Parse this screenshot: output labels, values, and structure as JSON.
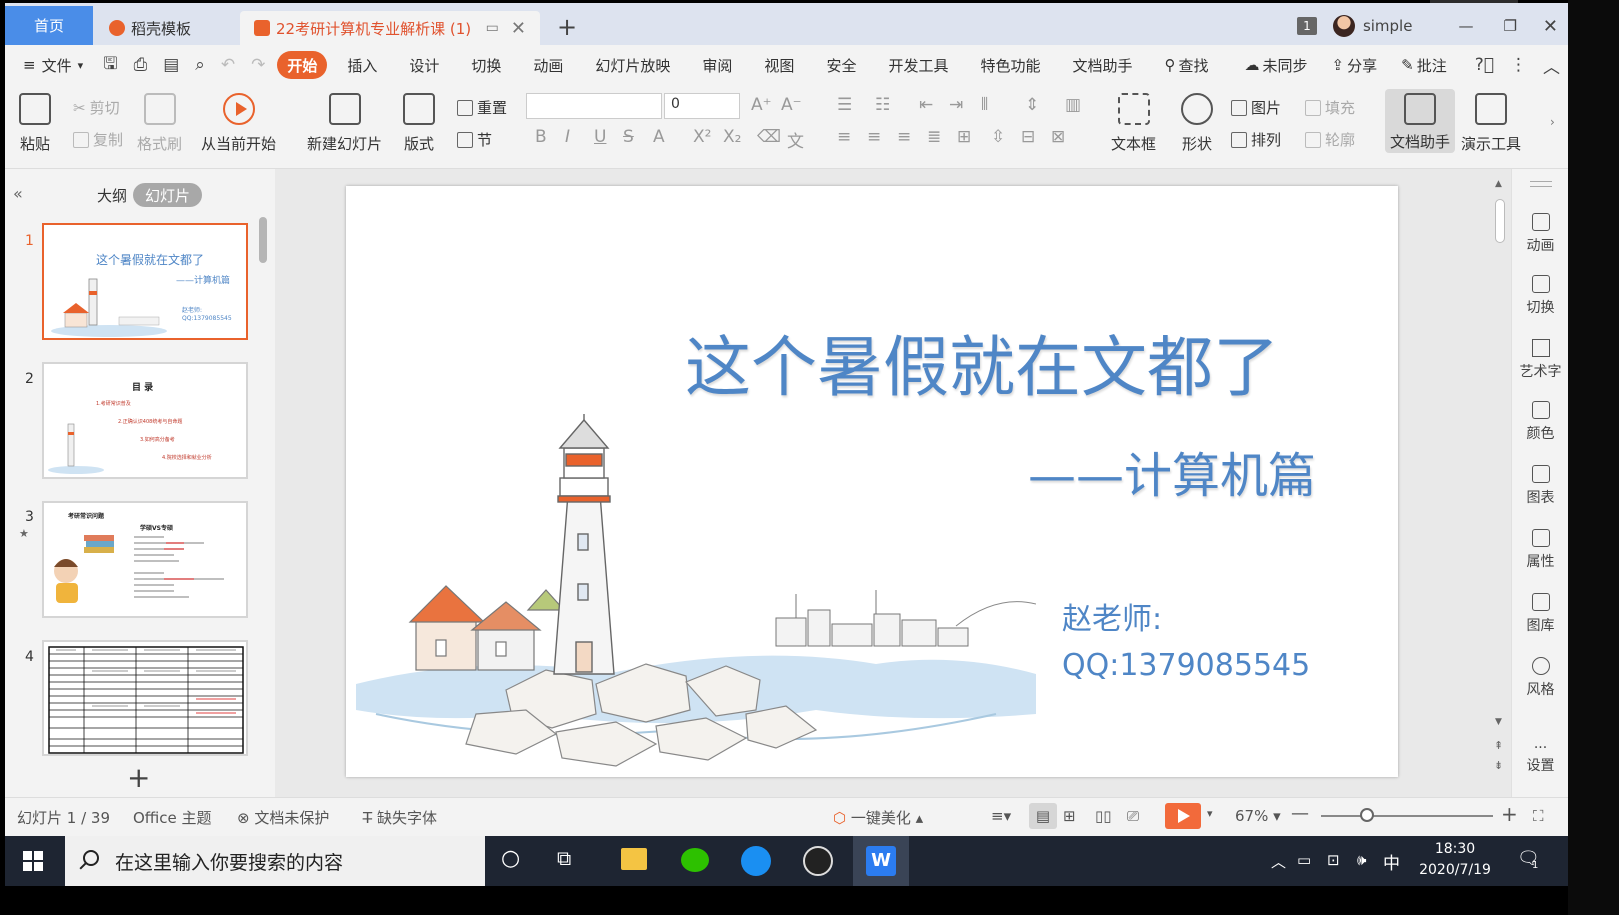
{
  "tabs": {
    "home": "首页",
    "template": "稻壳模板",
    "document": "22考研计算机专业解析课 (1)",
    "window_count": "1",
    "user": "simple"
  },
  "menu": {
    "file": "文件",
    "items": [
      "开始",
      "插入",
      "设计",
      "切换",
      "动画",
      "幻灯片放映",
      "审阅",
      "视图",
      "安全",
      "开发工具",
      "特色功能",
      "文档助手"
    ],
    "search": "查找",
    "sync": "未同步",
    "share": "分享",
    "comment": "批注"
  },
  "ribbon": {
    "paste": "粘贴",
    "cut": "剪切",
    "copy": "复制",
    "format_painter": "格式刷",
    "from_current": "从当前开始",
    "new_slide": "新建幻灯片",
    "layout": "版式",
    "reset": "重置",
    "section": "节",
    "font_size": "0",
    "textbox": "文本框",
    "shape": "形状",
    "picture": "图片",
    "fill": "填充",
    "arrange": "排列",
    "outline": "轮廓",
    "doc_assistant": "文档助手",
    "presenter_tools": "演示工具"
  },
  "left_panel": {
    "outline_tab": "大纲",
    "slides_tab": "幻灯片",
    "slide_numbers": [
      "1",
      "2",
      "3",
      "4"
    ],
    "thumb1": {
      "title": "这个暑假就在文都了",
      "sub": "——计算机篇",
      "teacher": "赵老师:",
      "qq": "QQ:1379085545"
    },
    "thumb2": {
      "title": "目 录",
      "items": [
        "1.考研常识普及",
        "2.正确认识408统考与自命题",
        "3.如何高分备考",
        "4.院校选择和就业分析"
      ]
    },
    "thumb3": {
      "header": "考研常识问题",
      "section": "学硕VS专硕"
    }
  },
  "slide": {
    "title": "这个暑假就在文都了",
    "subtitle": "——计算机篇",
    "teacher": "赵老师:",
    "qq": "QQ:1379085545"
  },
  "right_sidebar": [
    "动画",
    "切换",
    "艺术字",
    "颜色",
    "图表",
    "属性",
    "图库",
    "风格",
    "设置"
  ],
  "status": {
    "slide_counter": "幻灯片 1 / 39",
    "theme": "Office 主题",
    "protection": "文档未保护",
    "missing_font": "缺失字体",
    "beautify": "一键美化",
    "zoom": "67%"
  },
  "taskbar": {
    "search_placeholder": "在这里输入你要搜索的内容",
    "ime": "中",
    "time": "18:30",
    "date": "2020/7/19",
    "notifications": "1"
  },
  "colors": {
    "accent": "#e9622c",
    "title_blue": "#4f86c6",
    "home_tab": "#4a8de8"
  }
}
